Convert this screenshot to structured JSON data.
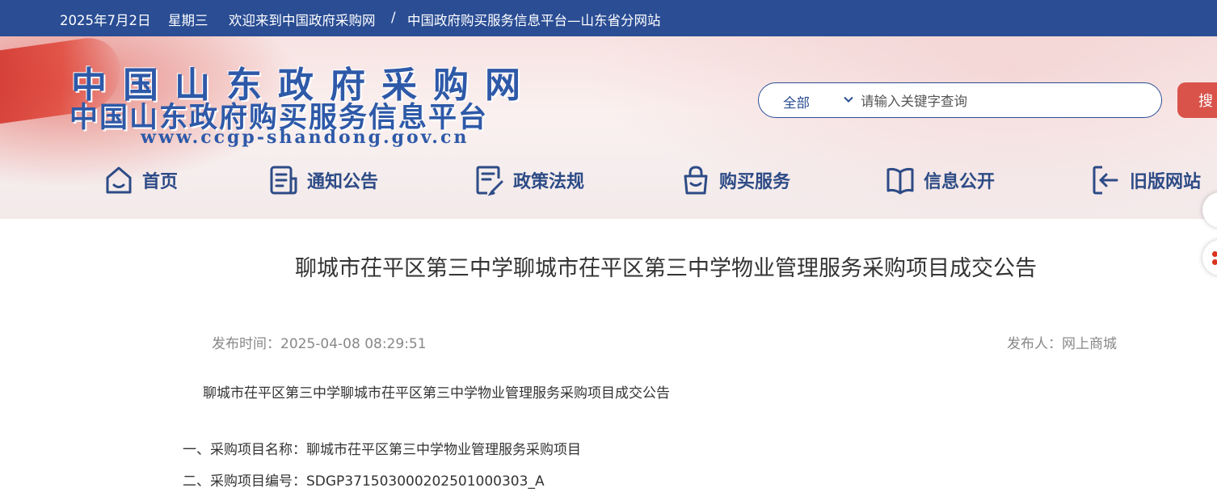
{
  "topbar": {
    "date": "2025年7月2日",
    "weekday": "星期三",
    "welcome": "欢迎来到中国政府采购网",
    "separator": "/",
    "subsite": "中国政府购买服务信息平台—山东省分网站"
  },
  "logo": {
    "title": "中国山东政府采购网",
    "subtitle": "中国山东政府购买服务信息平台",
    "url": "www.ccgp-shandong.gov.cn"
  },
  "search": {
    "category": "全部",
    "placeholder": "请输入关键字查询",
    "value": "",
    "button_label": "搜"
  },
  "nav": {
    "items": [
      {
        "label": "首页",
        "icon": "home-icon"
      },
      {
        "label": "通知公告",
        "icon": "notice-icon"
      },
      {
        "label": "政策法规",
        "icon": "policy-icon"
      },
      {
        "label": "购买服务",
        "icon": "shopping-bag-icon"
      },
      {
        "label": "信息公开",
        "icon": "open-book-icon"
      },
      {
        "label": "旧版网站",
        "icon": "back-arrow-icon"
      }
    ]
  },
  "colors": {
    "topbar_bg": "#2a4d94",
    "nav_text": "#2d4b86",
    "search_button": "#d9534a",
    "logo_blue": "#2e59a8"
  },
  "article": {
    "title": "聊城市茌平区第三中学聊城市茌平区第三中学物业管理服务采购项目成交公告",
    "publish_time": "发布时间：2025-04-08 08:29:51",
    "publisher": "发布人：网上商城",
    "intro": "聊城市茌平区第三中学聊城市茌平区第三中学物业管理服务采购项目成交公告",
    "items": [
      "一、采购项目名称：聊城市茌平区第三中学物业管理服务采购项目",
      "二、采购项目编号：SDGP371503000202501000303_A"
    ]
  }
}
